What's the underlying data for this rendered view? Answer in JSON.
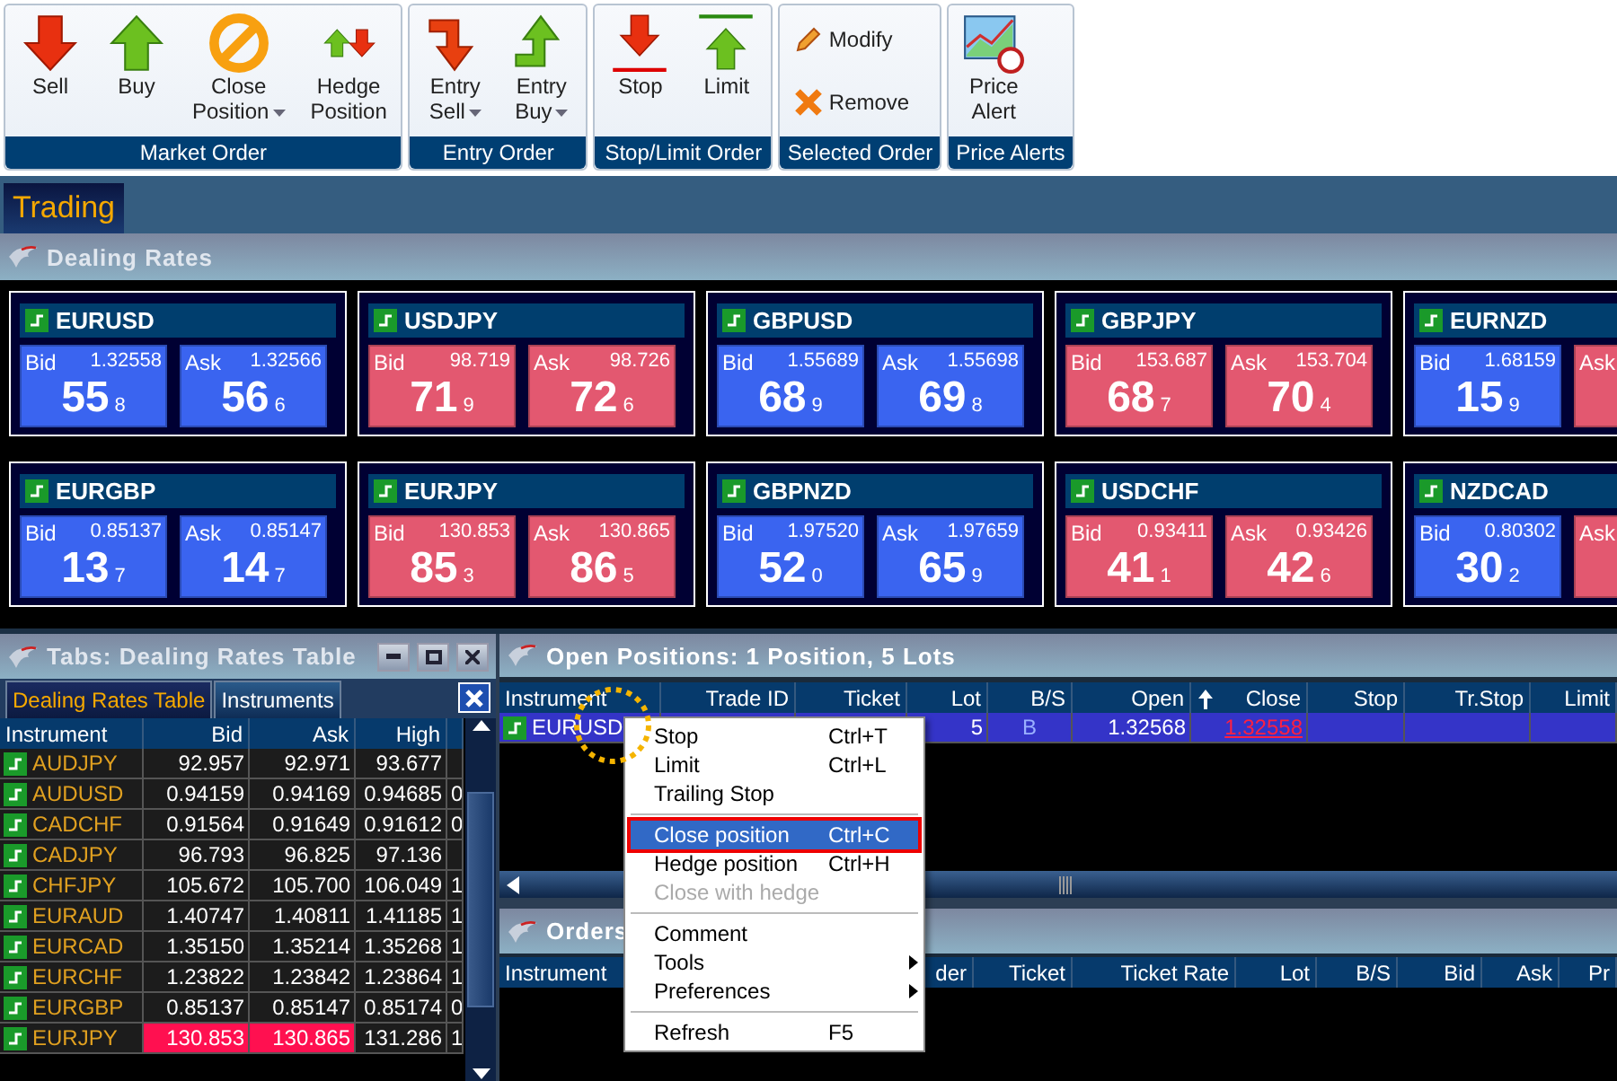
{
  "toolbar": {
    "groups": [
      {
        "label": "Market Order",
        "buttons": [
          {
            "label": "Sell",
            "kind": "large",
            "dropdown": false
          },
          {
            "label": "Buy",
            "kind": "large",
            "dropdown": false
          },
          {
            "label": "Close\nPosition",
            "kind": "large",
            "dropdown": true
          },
          {
            "label": "Hedge\nPosition",
            "kind": "large",
            "dropdown": false
          }
        ]
      },
      {
        "label": "Entry Order",
        "buttons": [
          {
            "label": "Entry\nSell",
            "kind": "large",
            "dropdown": true
          },
          {
            "label": "Entry\nBuy",
            "kind": "large",
            "dropdown": true
          }
        ]
      },
      {
        "label": "Stop/Limit Order",
        "buttons": [
          {
            "label": "Stop",
            "kind": "large",
            "dropdown": false
          },
          {
            "label": "Limit",
            "kind": "large",
            "dropdown": false
          }
        ]
      },
      {
        "label": "Selected Order",
        "buttons": [
          {
            "label": "Modify",
            "kind": "small",
            "dropdown": false
          },
          {
            "label": "Remove",
            "kind": "small",
            "dropdown": false
          }
        ]
      },
      {
        "label": "Price Alerts",
        "buttons": [
          {
            "label": "Price\nAlert",
            "kind": "large",
            "dropdown": false
          }
        ]
      }
    ]
  },
  "main_tabs": [
    {
      "label": "Trading",
      "selected": true
    }
  ],
  "dealing_rates": {
    "title": "Dealing Rates",
    "cards": [
      {
        "symbol": "EURUSD",
        "quotes": [
          {
            "label": "Bid",
            "price": "1.32558",
            "big": "55",
            "pip": "8",
            "color": "#3a64f0"
          },
          {
            "label": "Ask",
            "price": "1.32566",
            "big": "56",
            "pip": "6",
            "color": "#3a64f0"
          }
        ]
      },
      {
        "symbol": "USDJPY",
        "quotes": [
          {
            "label": "Bid",
            "price": "98.719",
            "big": "71",
            "pip": "9",
            "color": "#e35870"
          },
          {
            "label": "Ask",
            "price": "98.726",
            "big": "72",
            "pip": "6",
            "color": "#e35870"
          }
        ]
      },
      {
        "symbol": "GBPUSD",
        "quotes": [
          {
            "label": "Bid",
            "price": "1.55689",
            "big": "68",
            "pip": "9",
            "color": "#3a64f0"
          },
          {
            "label": "Ask",
            "price": "1.55698",
            "big": "69",
            "pip": "8",
            "color": "#3a64f0"
          }
        ]
      },
      {
        "symbol": "GBPJPY",
        "quotes": [
          {
            "label": "Bid",
            "price": "153.687",
            "big": "68",
            "pip": "7",
            "color": "#e35870"
          },
          {
            "label": "Ask",
            "price": "153.704",
            "big": "70",
            "pip": "4",
            "color": "#e35870"
          }
        ]
      },
      {
        "symbol": "EURNZD",
        "quotes": [
          {
            "label": "Bid",
            "price": "1.68159",
            "big": "15",
            "pip": "9",
            "color": "#3a64f0"
          },
          {
            "label": "Ask",
            "color": "#e35870"
          }
        ]
      },
      {
        "symbol": "EURGBP",
        "quotes": [
          {
            "label": "Bid",
            "price": "0.85137",
            "big": "13",
            "pip": "7",
            "color": "#3a64f0"
          },
          {
            "label": "Ask",
            "price": "0.85147",
            "big": "14",
            "pip": "7",
            "color": "#3a64f0"
          }
        ]
      },
      {
        "symbol": "EURJPY",
        "quotes": [
          {
            "label": "Bid",
            "price": "130.853",
            "big": "85",
            "pip": "3",
            "color": "#e35870"
          },
          {
            "label": "Ask",
            "price": "130.865",
            "big": "86",
            "pip": "5",
            "color": "#e35870"
          }
        ]
      },
      {
        "symbol": "GBPNZD",
        "quotes": [
          {
            "label": "Bid",
            "price": "1.97520",
            "big": "52",
            "pip": "0",
            "color": "#3a64f0"
          },
          {
            "label": "Ask",
            "price": "1.97659",
            "big": "65",
            "pip": "9",
            "color": "#3a64f0"
          }
        ]
      },
      {
        "symbol": "USDCHF",
        "quotes": [
          {
            "label": "Bid",
            "price": "0.93411",
            "big": "41",
            "pip": "1",
            "color": "#e35870"
          },
          {
            "label": "Ask",
            "price": "0.93426",
            "big": "42",
            "pip": "6",
            "color": "#e35870"
          }
        ]
      },
      {
        "symbol": "NZDCAD",
        "quotes": [
          {
            "label": "Bid",
            "price": "0.80302",
            "big": "30",
            "pip": "2",
            "color": "#3a64f0"
          },
          {
            "label": "Ask",
            "color": "#e35870"
          }
        ]
      }
    ]
  },
  "rates_table_panel": {
    "title": "Tabs: Dealing Rates Table",
    "tabs": [
      {
        "label": "Dealing Rates Table",
        "selected": true
      },
      {
        "label": "Instruments",
        "selected": false
      }
    ],
    "columns": [
      "Instrument",
      "Bid",
      "Ask",
      "High"
    ],
    "rows": [
      {
        "instrument": "AUDJPY",
        "bid": "92.957",
        "ask": "92.971",
        "high": "93.677",
        "column_5": "",
        "highlight": false
      },
      {
        "instrument": "AUDUSD",
        "bid": "0.94159",
        "ask": "0.94169",
        "high": "0.94685",
        "column_5": "0",
        "highlight": false
      },
      {
        "instrument": "CADCHF",
        "bid": "0.91564",
        "ask": "0.91649",
        "high": "0.91612",
        "column_5": "0",
        "highlight": false
      },
      {
        "instrument": "CADJPY",
        "bid": "96.793",
        "ask": "96.825",
        "high": "97.136",
        "column_5": "",
        "highlight": false
      },
      {
        "instrument": "CHFJPY",
        "bid": "105.672",
        "ask": "105.700",
        "high": "106.049",
        "column_5": "1",
        "highlight": false
      },
      {
        "instrument": "EURAUD",
        "bid": "1.40747",
        "ask": "1.40811",
        "high": "1.41185",
        "column_5": "1",
        "highlight": false
      },
      {
        "instrument": "EURCAD",
        "bid": "1.35150",
        "ask": "1.35214",
        "high": "1.35268",
        "column_5": "1",
        "highlight": false
      },
      {
        "instrument": "EURCHF",
        "bid": "1.23822",
        "ask": "1.23842",
        "high": "1.23864",
        "column_5": "1",
        "highlight": false
      },
      {
        "instrument": "EURGBP",
        "bid": "0.85137",
        "ask": "0.85147",
        "high": "0.85174",
        "column_5": "0",
        "highlight": false
      },
      {
        "instrument": "EURJPY",
        "bid": "130.853",
        "ask": "130.865",
        "high": "131.286",
        "column_5": "1",
        "highlight": true
      }
    ]
  },
  "open_positions": {
    "title": "Open Positions: 1 Position, 5 Lots",
    "columns": [
      "Instrument",
      "Trade ID",
      "Ticket",
      "Lot",
      "B/S",
      "Open",
      "Close",
      "Stop",
      "Tr.Stop",
      "Limit"
    ],
    "rows": [
      {
        "selected": true,
        "cells": [
          "EURUSD",
          "",
          "",
          "5",
          "B",
          "1.32568",
          "1.32558",
          "",
          "",
          ""
        ]
      }
    ]
  },
  "orders": {
    "title": "Orders",
    "columns": [
      "Instrument",
      "der",
      "Ticket",
      "Ticket Rate",
      "Lot",
      "B/S",
      "Bid",
      "Ask",
      "Pr"
    ]
  },
  "context_menu": {
    "items": [
      {
        "kind": "item",
        "label": "Stop",
        "shortcut": "Ctrl+T",
        "selected": false,
        "disabled": false
      },
      {
        "kind": "item",
        "label": "Limit",
        "shortcut": "Ctrl+L",
        "selected": false,
        "disabled": false
      },
      {
        "kind": "item",
        "label": "Trailing Stop",
        "selected": false,
        "disabled": false
      },
      {
        "kind": "separator"
      },
      {
        "kind": "item",
        "label": "Close position",
        "shortcut": "Ctrl+C",
        "selected": true,
        "disabled": false
      },
      {
        "kind": "item",
        "label": "Hedge position",
        "shortcut": "Ctrl+H",
        "selected": false,
        "disabled": false
      },
      {
        "kind": "item",
        "label": "Close with hedge",
        "selected": false,
        "disabled": true
      },
      {
        "kind": "separator"
      },
      {
        "kind": "item",
        "label": "Comment",
        "selected": false,
        "disabled": false
      },
      {
        "kind": "submenu",
        "label": "Tools",
        "selected": false,
        "disabled": false
      },
      {
        "kind": "submenu",
        "label": "Preferences",
        "selected": false,
        "disabled": false
      },
      {
        "kind": "separator"
      },
      {
        "kind": "item",
        "label": "Refresh",
        "shortcut": "F5",
        "selected": false,
        "disabled": false
      }
    ]
  }
}
